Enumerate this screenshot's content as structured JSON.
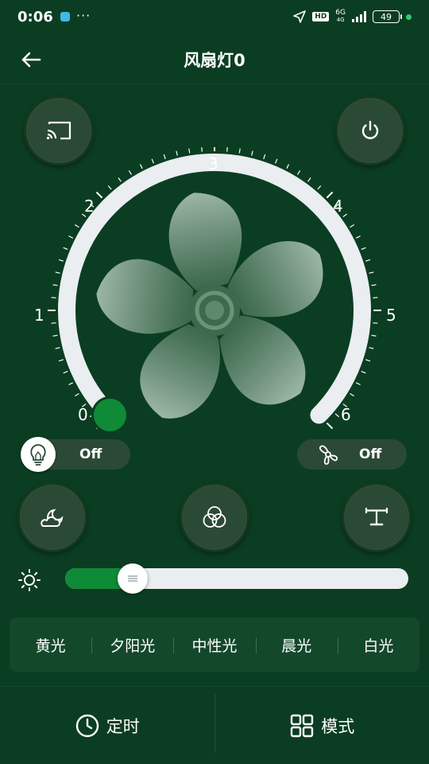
{
  "status_bar": {
    "time": "0:06",
    "more": "···",
    "hd": "HD",
    "network": "6G",
    "network_sub": "4G",
    "battery": "49"
  },
  "header": {
    "title": "风扇灯0"
  },
  "dial": {
    "labels": [
      "0",
      "1",
      "2",
      "3",
      "4",
      "5",
      "6"
    ],
    "current_speed": 0,
    "max_speed": 6
  },
  "light_toggle": {
    "label": "Off"
  },
  "fan_toggle": {
    "label": "Off"
  },
  "brightness": {
    "level": 0.12
  },
  "color_temps": [
    "黄光",
    "夕阳光",
    "中性光",
    "晨光",
    "白光"
  ],
  "bottom_nav": {
    "timer_label": "定时",
    "mode_label": "模式"
  },
  "colors": {
    "background": "#0b3d22",
    "button": "#2b4a35",
    "accent_green": "#0f8a36",
    "track": "#eaeef0"
  }
}
